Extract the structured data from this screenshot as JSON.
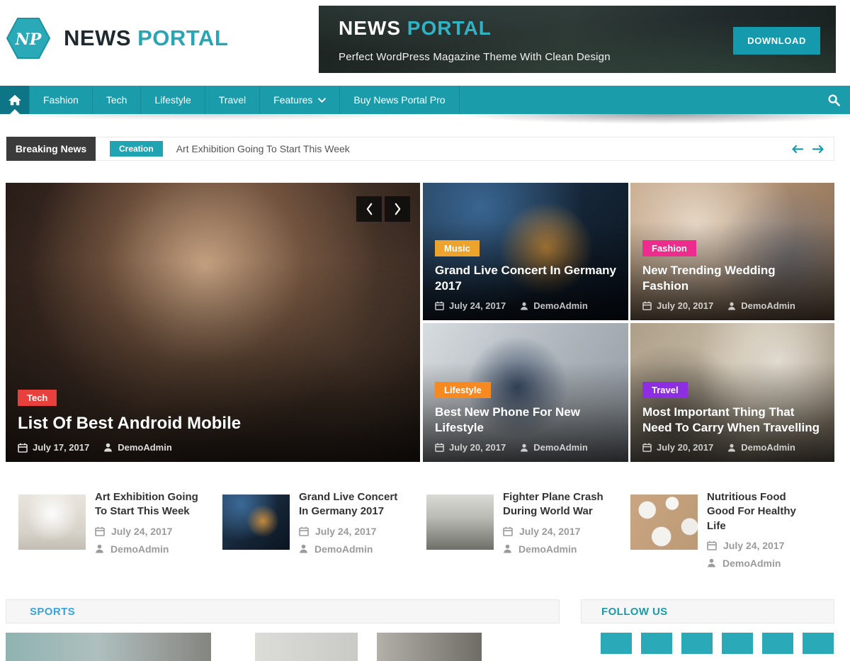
{
  "header": {
    "logo_text": "NP",
    "site_name_primary": "NEWS",
    "site_name_secondary": "PORTAL",
    "banner": {
      "title_primary": "NEWS",
      "title_secondary": "PORTAL",
      "tagline": "Perfect  WordPress Magazine Theme With Clean Design",
      "download_label": "DOWNLOAD"
    }
  },
  "nav": {
    "items": [
      "Fashion",
      "Tech",
      "Lifestyle",
      "Travel",
      "Features",
      "Buy News Portal Pro"
    ]
  },
  "ticker": {
    "label": "Breaking News",
    "category_badge": "Creation",
    "headline": "Art Exhibition Going To Start This Week"
  },
  "featured": {
    "main": {
      "category": "Tech",
      "category_color": "#e8403c",
      "title": "List Of Best Android Mobile",
      "date": "July 17, 2017",
      "author": "DemoAdmin"
    },
    "tiles": [
      {
        "category": "Music",
        "category_color": "#eca42c",
        "title": "Grand Live Concert In Germany 2017",
        "date": "July 24, 2017",
        "author": "DemoAdmin"
      },
      {
        "category": "Fashion",
        "category_color": "#ee2c8d",
        "title": "New Trending Wedding Fashion",
        "date": "July 20, 2017",
        "author": "DemoAdmin"
      },
      {
        "category": "Lifestyle",
        "category_color": "#f6891f",
        "title": "Best New Phone For New Lifestyle",
        "date": "July 20, 2017",
        "author": "DemoAdmin"
      },
      {
        "category": "Travel",
        "category_color": "#8d2ee3",
        "title": "Most Important Thing That Need To Carry When Travelling",
        "date": "July 20, 2017",
        "author": "DemoAdmin"
      }
    ]
  },
  "recent_posts": [
    {
      "title": "Art Exhibition Going To Start This Week",
      "date": "July 24, 2017",
      "author": "DemoAdmin"
    },
    {
      "title": "Grand Live Concert In Germany 2017",
      "date": "July 24, 2017",
      "author": "DemoAdmin"
    },
    {
      "title": "Fighter Plane Crash During World War",
      "date": "July 24, 2017",
      "author": "DemoAdmin"
    },
    {
      "title": "Nutritious Food Good For Healthy Life",
      "date": "July 24, 2017",
      "author": "DemoAdmin"
    }
  ],
  "sections": {
    "sports": {
      "title": "SPORTS",
      "accent_color": "#38a3da"
    },
    "follow_us": {
      "title": "FOLLOW US",
      "accent_color": "#1b9aaa"
    }
  },
  "theme": {
    "primary_teal": "#1b9cab",
    "nav_active_teal": "#0d7585",
    "ticker_label_bg": "#3b3b3b"
  }
}
